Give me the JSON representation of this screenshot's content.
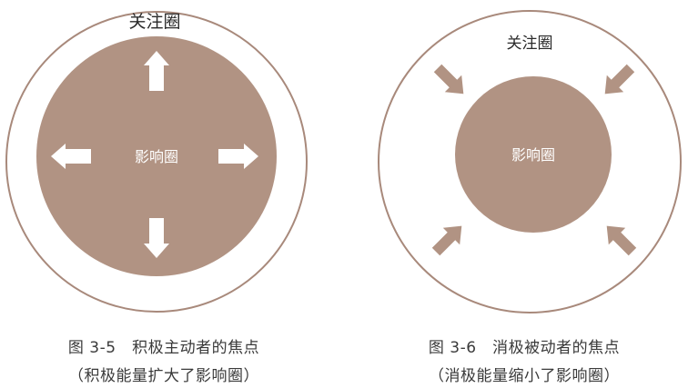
{
  "left_figure": {
    "outer_label": "关注圈",
    "inner_label": "影响圈",
    "caption_line1": "图 3-5　积极主动者的焦点",
    "caption_line2": "（积极能量扩大了影响圈）"
  },
  "right_figure": {
    "outer_label": "关注圈",
    "inner_label": "影响圈",
    "caption_line1": "图 3-6　消极被动者的焦点",
    "caption_line2": "（消极能量缩小了影响圈）"
  },
  "colors": {
    "circle_stroke": "#a8897b",
    "fill": "#b19383",
    "arrow_white": "#ffffff"
  }
}
